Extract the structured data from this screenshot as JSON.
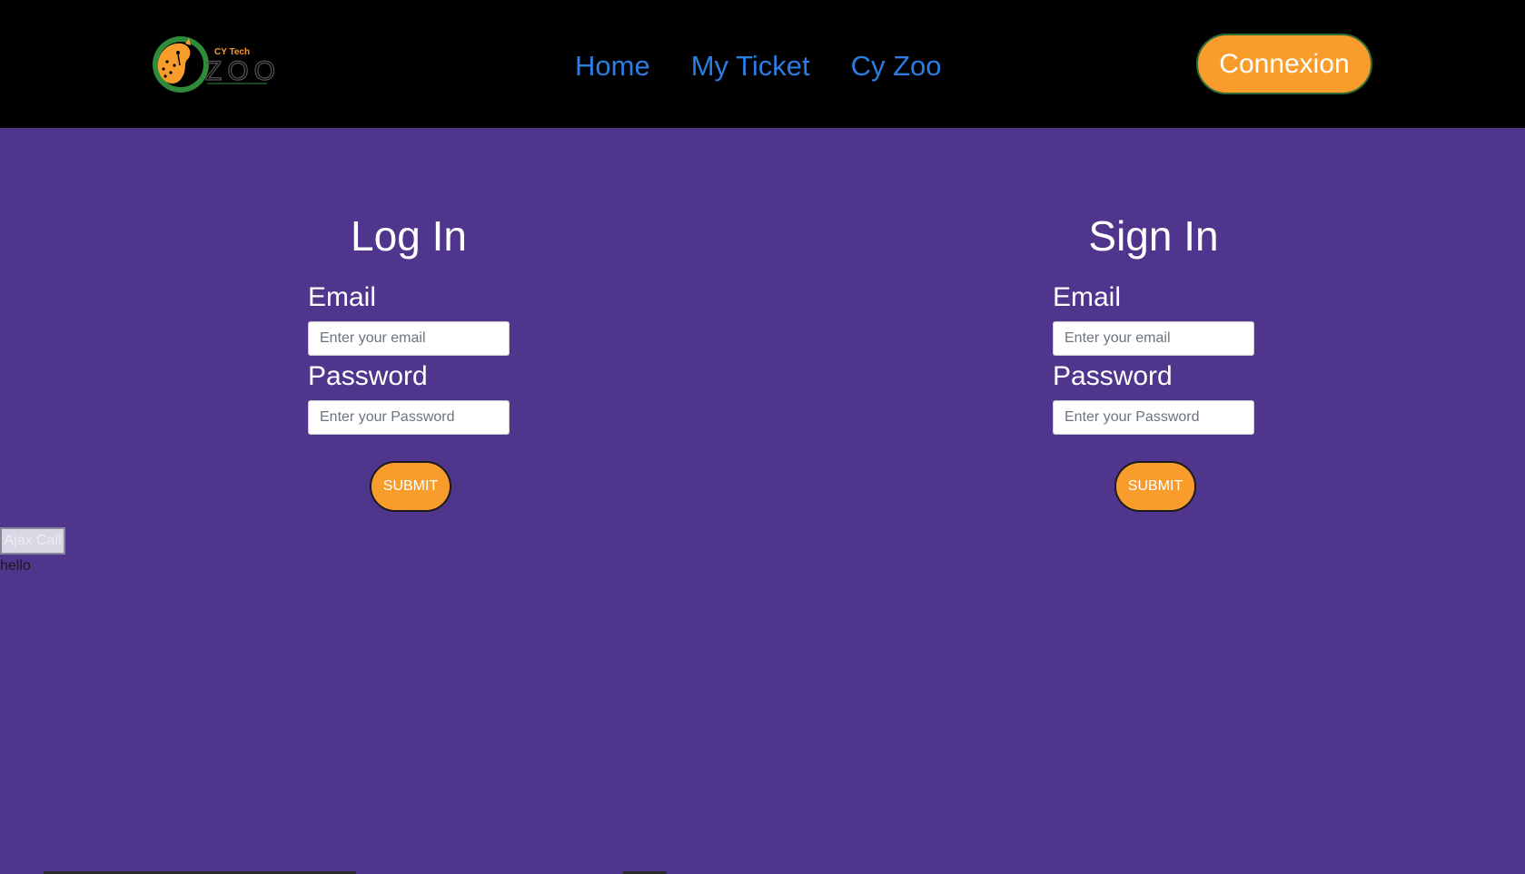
{
  "header": {
    "logo": {
      "top_text": "CY Tech",
      "main_text": "ZOO",
      "icon": "cheetah-logo-icon"
    },
    "nav": [
      {
        "label": "Home"
      },
      {
        "label": "My Ticket"
      },
      {
        "label": "Cy Zoo"
      }
    ],
    "connexion_label": "Connexion"
  },
  "login": {
    "title": "Log In",
    "email_label": "Email",
    "email_placeholder": "Enter your email",
    "password_label": "Password",
    "password_placeholder": "Enter your Password",
    "submit_label": "SUBMIT"
  },
  "signin": {
    "title": "Sign In",
    "email_label": "Email",
    "email_placeholder": "Enter your email",
    "password_label": "Password",
    "password_placeholder": "Enter your Password",
    "submit_label": "SUBMIT"
  },
  "ajax": {
    "button_label": "Ajax Call",
    "output_text": "hello"
  },
  "colors": {
    "background": "#4f358b",
    "header_bg": "#000000",
    "nav_link": "#2a7de1",
    "accent_orange": "#f89c2c",
    "logo_green": "#2e8b3a"
  }
}
